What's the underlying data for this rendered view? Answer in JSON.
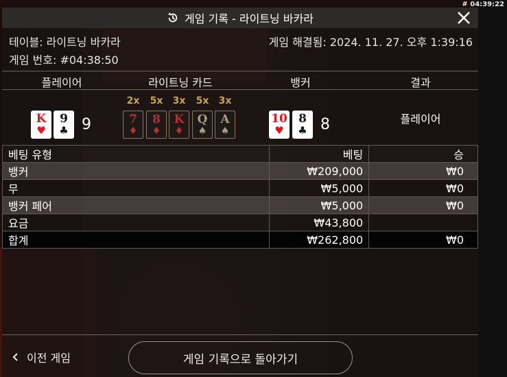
{
  "top_id": "# 04:39:22",
  "title": "게임 기록 - 라이트닝 바카라",
  "info": {
    "table_label": "테이블: 라이트닝 바카라",
    "resolved_label": "게임 해결됨: 2024. 11. 27. 오후 1:39:16",
    "game_number_label": "게임 번호: #04:38:50"
  },
  "columns": {
    "player": "플레이어",
    "lightning": "라이트닝 카드",
    "banker": "뱅커",
    "result": "결과"
  },
  "player": {
    "cards": [
      {
        "rank": "K",
        "suit": "♥",
        "color": "red"
      },
      {
        "rank": "9",
        "suit": "♣",
        "color": "black"
      }
    ],
    "score": "9"
  },
  "lightning_cards": [
    {
      "mult": "2x",
      "rank": "7",
      "suit": "♦",
      "color": "red"
    },
    {
      "mult": "5x",
      "rank": "8",
      "suit": "♦",
      "color": "red"
    },
    {
      "mult": "3x",
      "rank": "K",
      "suit": "♦",
      "color": "red"
    },
    {
      "mult": "5x",
      "rank": "Q",
      "suit": "♠",
      "color": "gray"
    },
    {
      "mult": "3x",
      "rank": "A",
      "suit": "♠",
      "color": "gray"
    }
  ],
  "banker": {
    "cards": [
      {
        "rank": "10",
        "suit": "♥",
        "color": "red"
      },
      {
        "rank": "8",
        "suit": "♣",
        "color": "black"
      }
    ],
    "score": "8"
  },
  "result": "플레이어",
  "bets_table": {
    "headers": {
      "type": "베팅 유형",
      "bet": "베팅",
      "win": "승"
    },
    "rows": [
      {
        "type": "뱅커",
        "bet": "₩209,000",
        "win": "₩0"
      },
      {
        "type": "무",
        "bet": "₩5,000",
        "win": "₩0"
      },
      {
        "type": "뱅커 페어",
        "bet": "₩5,000",
        "win": "₩0"
      },
      {
        "type": "요금",
        "bet": "₩43,800",
        "win": ""
      }
    ],
    "total": {
      "type": "합계",
      "bet": "₩262,800",
      "win": "₩0"
    }
  },
  "footer": {
    "prev": "이전 게임",
    "back": "게임 기록으로 돌아가기"
  },
  "icons": {
    "title": "history-icon",
    "close": "close-icon",
    "prev": "chevron-left-icon"
  }
}
